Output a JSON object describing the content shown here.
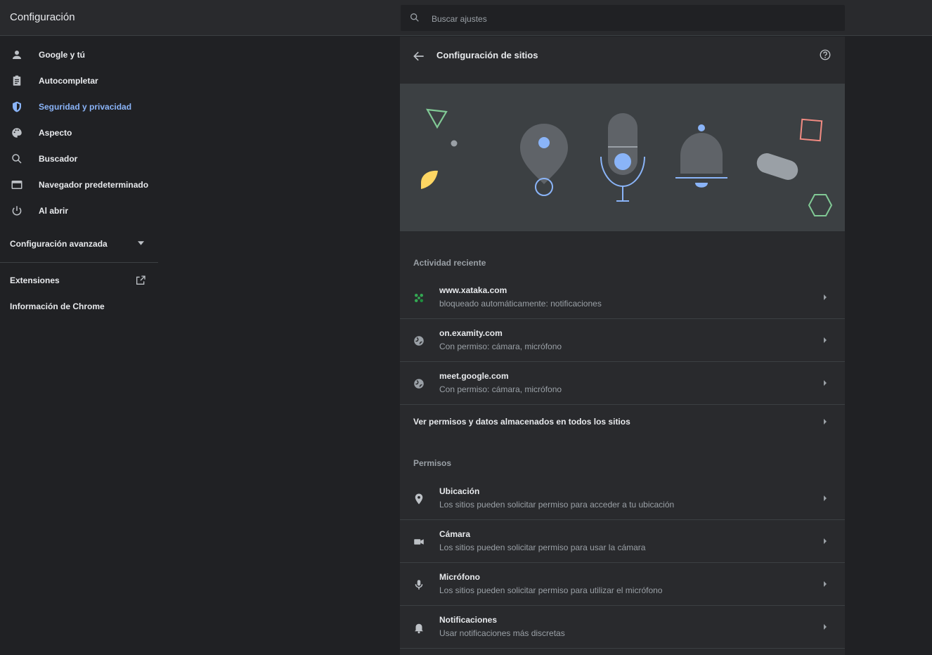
{
  "header": {
    "title": "Configuración",
    "search_placeholder": "Buscar ajustes"
  },
  "sidebar": {
    "items": [
      {
        "label": "Google y tú",
        "icon": "person-icon"
      },
      {
        "label": "Autocompletar",
        "icon": "clipboard-icon"
      },
      {
        "label": "Seguridad y privacidad",
        "icon": "shield-icon",
        "active": true
      },
      {
        "label": "Aspecto",
        "icon": "palette-icon"
      },
      {
        "label": "Buscador",
        "icon": "search-icon"
      },
      {
        "label": "Navegador predeterminado",
        "icon": "browser-icon"
      },
      {
        "label": "Al abrir",
        "icon": "power-icon"
      }
    ],
    "advanced_label": "Configuración avanzada",
    "extensions_label": "Extensiones",
    "about_label": "Información de Chrome"
  },
  "panel": {
    "title": "Configuración de sitios",
    "recent_heading": "Actividad reciente",
    "recent": [
      {
        "site": "www.xataka.com",
        "detail": "bloqueado automáticamente: notificaciones",
        "icon": "site-favicon-icon"
      },
      {
        "site": "on.examity.com",
        "detail": "Con permiso: cámara, micrófono",
        "icon": "globe-icon"
      },
      {
        "site": "meet.google.com",
        "detail": "Con permiso: cámara, micrófono",
        "icon": "globe-icon"
      }
    ],
    "all_sites_label": "Ver permisos y datos almacenados en todos los sitios",
    "permissions_heading": "Permisos",
    "permissions": [
      {
        "title": "Ubicación",
        "detail": "Los sitios pueden solicitar permiso para acceder a tu ubicación",
        "icon": "location-pin-icon"
      },
      {
        "title": "Cámara",
        "detail": "Los sitios pueden solicitar permiso para usar la cámara",
        "icon": "camera-icon"
      },
      {
        "title": "Micrófono",
        "detail": "Los sitios pueden solicitar permiso para utilizar el micrófono",
        "icon": "microphone-icon"
      },
      {
        "title": "Notificaciones",
        "detail": "Usar notificaciones más discretas",
        "icon": "bell-icon"
      }
    ]
  },
  "colors": {
    "background": "#202124",
    "surface": "#292a2d",
    "banner": "#3c4043",
    "accent": "#8ab4f8",
    "text": "#e8eaed",
    "secondary_text": "#9aa0a6"
  }
}
